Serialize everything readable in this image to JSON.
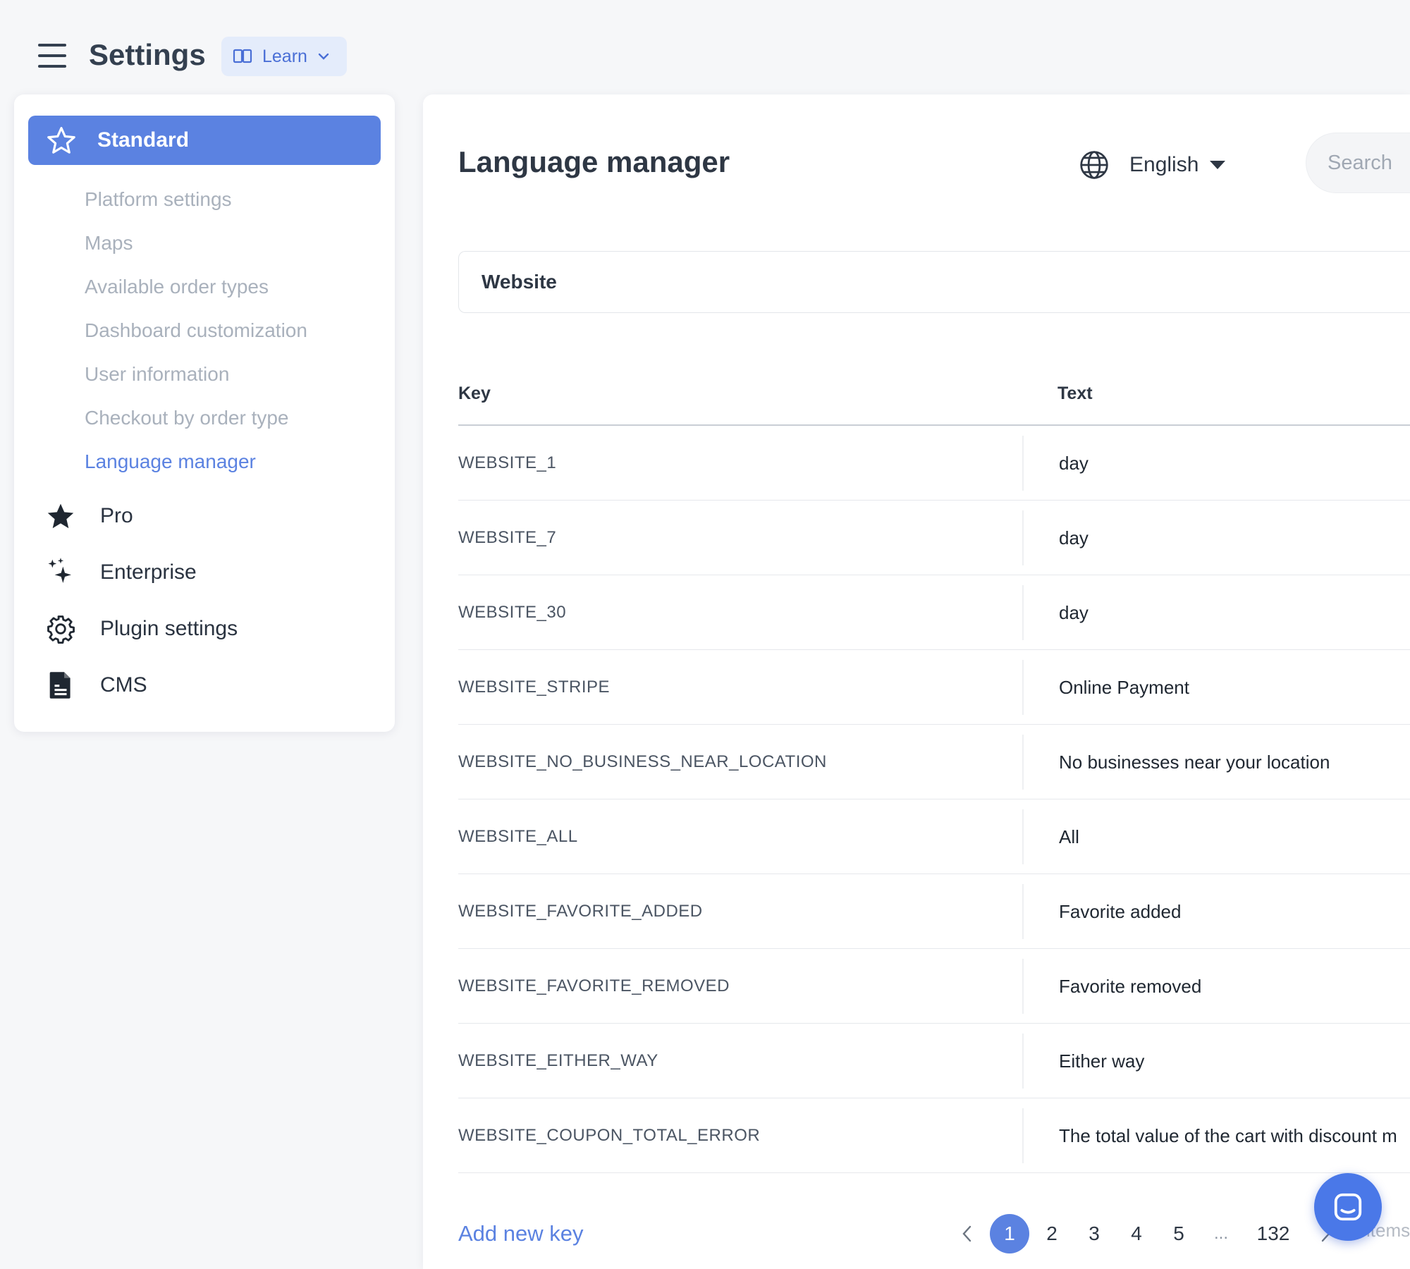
{
  "header": {
    "title": "Settings",
    "learn_label": "Learn"
  },
  "sidebar": {
    "standard_label": "Standard",
    "submenu": [
      {
        "label": "Platform settings",
        "active": false
      },
      {
        "label": "Maps",
        "active": false
      },
      {
        "label": "Available order types",
        "active": false
      },
      {
        "label": "Dashboard customization",
        "active": false
      },
      {
        "label": "User information",
        "active": false
      },
      {
        "label": "Checkout by order type",
        "active": false
      },
      {
        "label": "Language manager",
        "active": true
      }
    ],
    "items": [
      {
        "label": "Pro",
        "icon": "star-filled-icon"
      },
      {
        "label": "Enterprise",
        "icon": "sparkles-icon"
      },
      {
        "label": "Plugin settings",
        "icon": "gear-icon"
      },
      {
        "label": "CMS",
        "icon": "document-icon"
      }
    ]
  },
  "main": {
    "title": "Language manager",
    "language": "English",
    "search_placeholder": "Search",
    "category": "Website",
    "columns": {
      "key": "Key",
      "text": "Text"
    },
    "rows": [
      {
        "key": "WEBSITE_1",
        "text": "day"
      },
      {
        "key": "WEBSITE_7",
        "text": "day"
      },
      {
        "key": "WEBSITE_30",
        "text": "day"
      },
      {
        "key": "WEBSITE_STRIPE",
        "text": "Online Payment"
      },
      {
        "key": "WEBSITE_NO_BUSINESS_NEAR_LOCATION",
        "text": "No businesses near your location"
      },
      {
        "key": "WEBSITE_ALL",
        "text": "All"
      },
      {
        "key": "WEBSITE_FAVORITE_ADDED",
        "text": "Favorite added"
      },
      {
        "key": "WEBSITE_FAVORITE_REMOVED",
        "text": "Favorite removed"
      },
      {
        "key": "WEBSITE_EITHER_WAY",
        "text": "Either way"
      },
      {
        "key": "WEBSITE_COUPON_TOTAL_ERROR",
        "text": "The total value of the cart with discount m"
      }
    ],
    "add_key_label": "Add new key",
    "pagination": {
      "pages": [
        "1",
        "2",
        "3",
        "4",
        "5",
        "...",
        "132"
      ],
      "current": "1",
      "items_label": "items"
    }
  },
  "colors": {
    "accent": "#5b82e1",
    "text_primary": "#2e3744",
    "text_muted": "#a9b1bc",
    "background": "#f6f7f9"
  }
}
